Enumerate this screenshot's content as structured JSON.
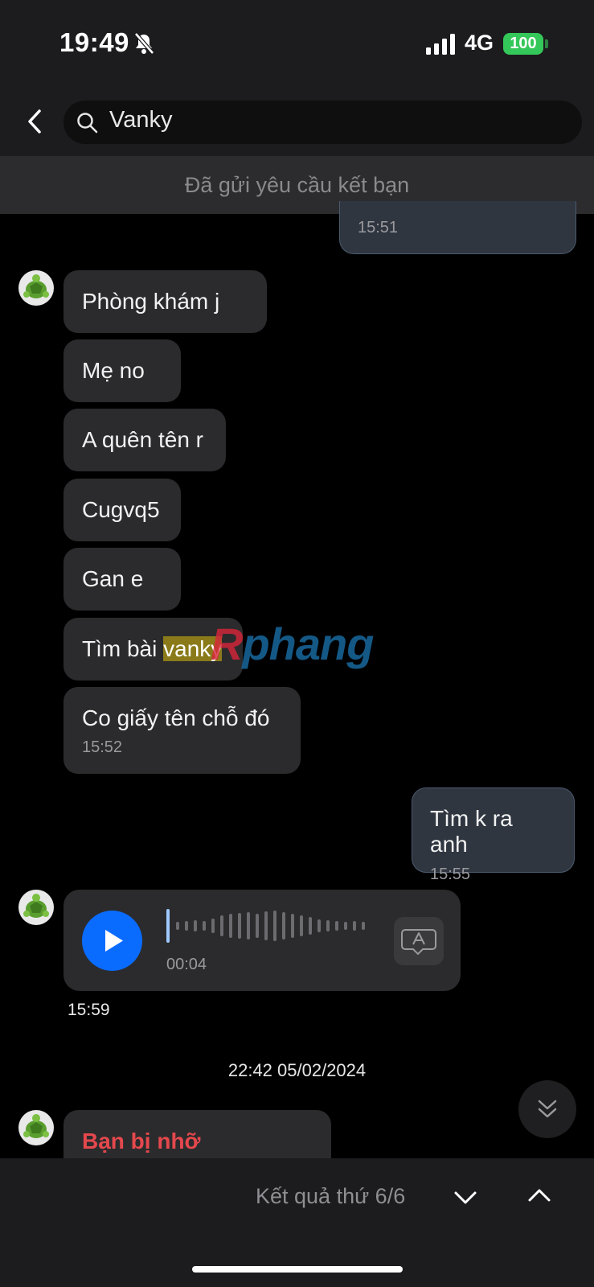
{
  "status": {
    "time": "19:49",
    "network": "4G",
    "battery": "100"
  },
  "header": {
    "search_value": "Vanky",
    "friend_request": "Đã gửi yêu cầu kết bạn"
  },
  "messages": {
    "top_mine_ts": "15:51",
    "m1": "Phòng khám j",
    "m2": "Mẹ no",
    "m3": "A quên tên r",
    "m4": "Cugvq5",
    "m5": "Gan e",
    "m6_pre": "Tìm bài ",
    "m6_hl": "vanky",
    "m7": "Co giấy tên chỗ đó",
    "m7_ts": "15:52",
    "mine2": "Tìm k ra anh",
    "mine2_ts": "15:55",
    "voice_duration": "00:04",
    "voice_ts": "15:59",
    "date_sep": "22:42 05/02/2024",
    "last_preview": "Bạn bị nhỡ"
  },
  "footer": {
    "result_text": "Kết quả thứ 6/6"
  },
  "watermark": {
    "r": "R",
    "rest": "phang"
  },
  "colors": {
    "accent": "#0a6cff",
    "battery": "#34c759",
    "missed": "#e5484d",
    "highlight": "#8a7a1a"
  }
}
